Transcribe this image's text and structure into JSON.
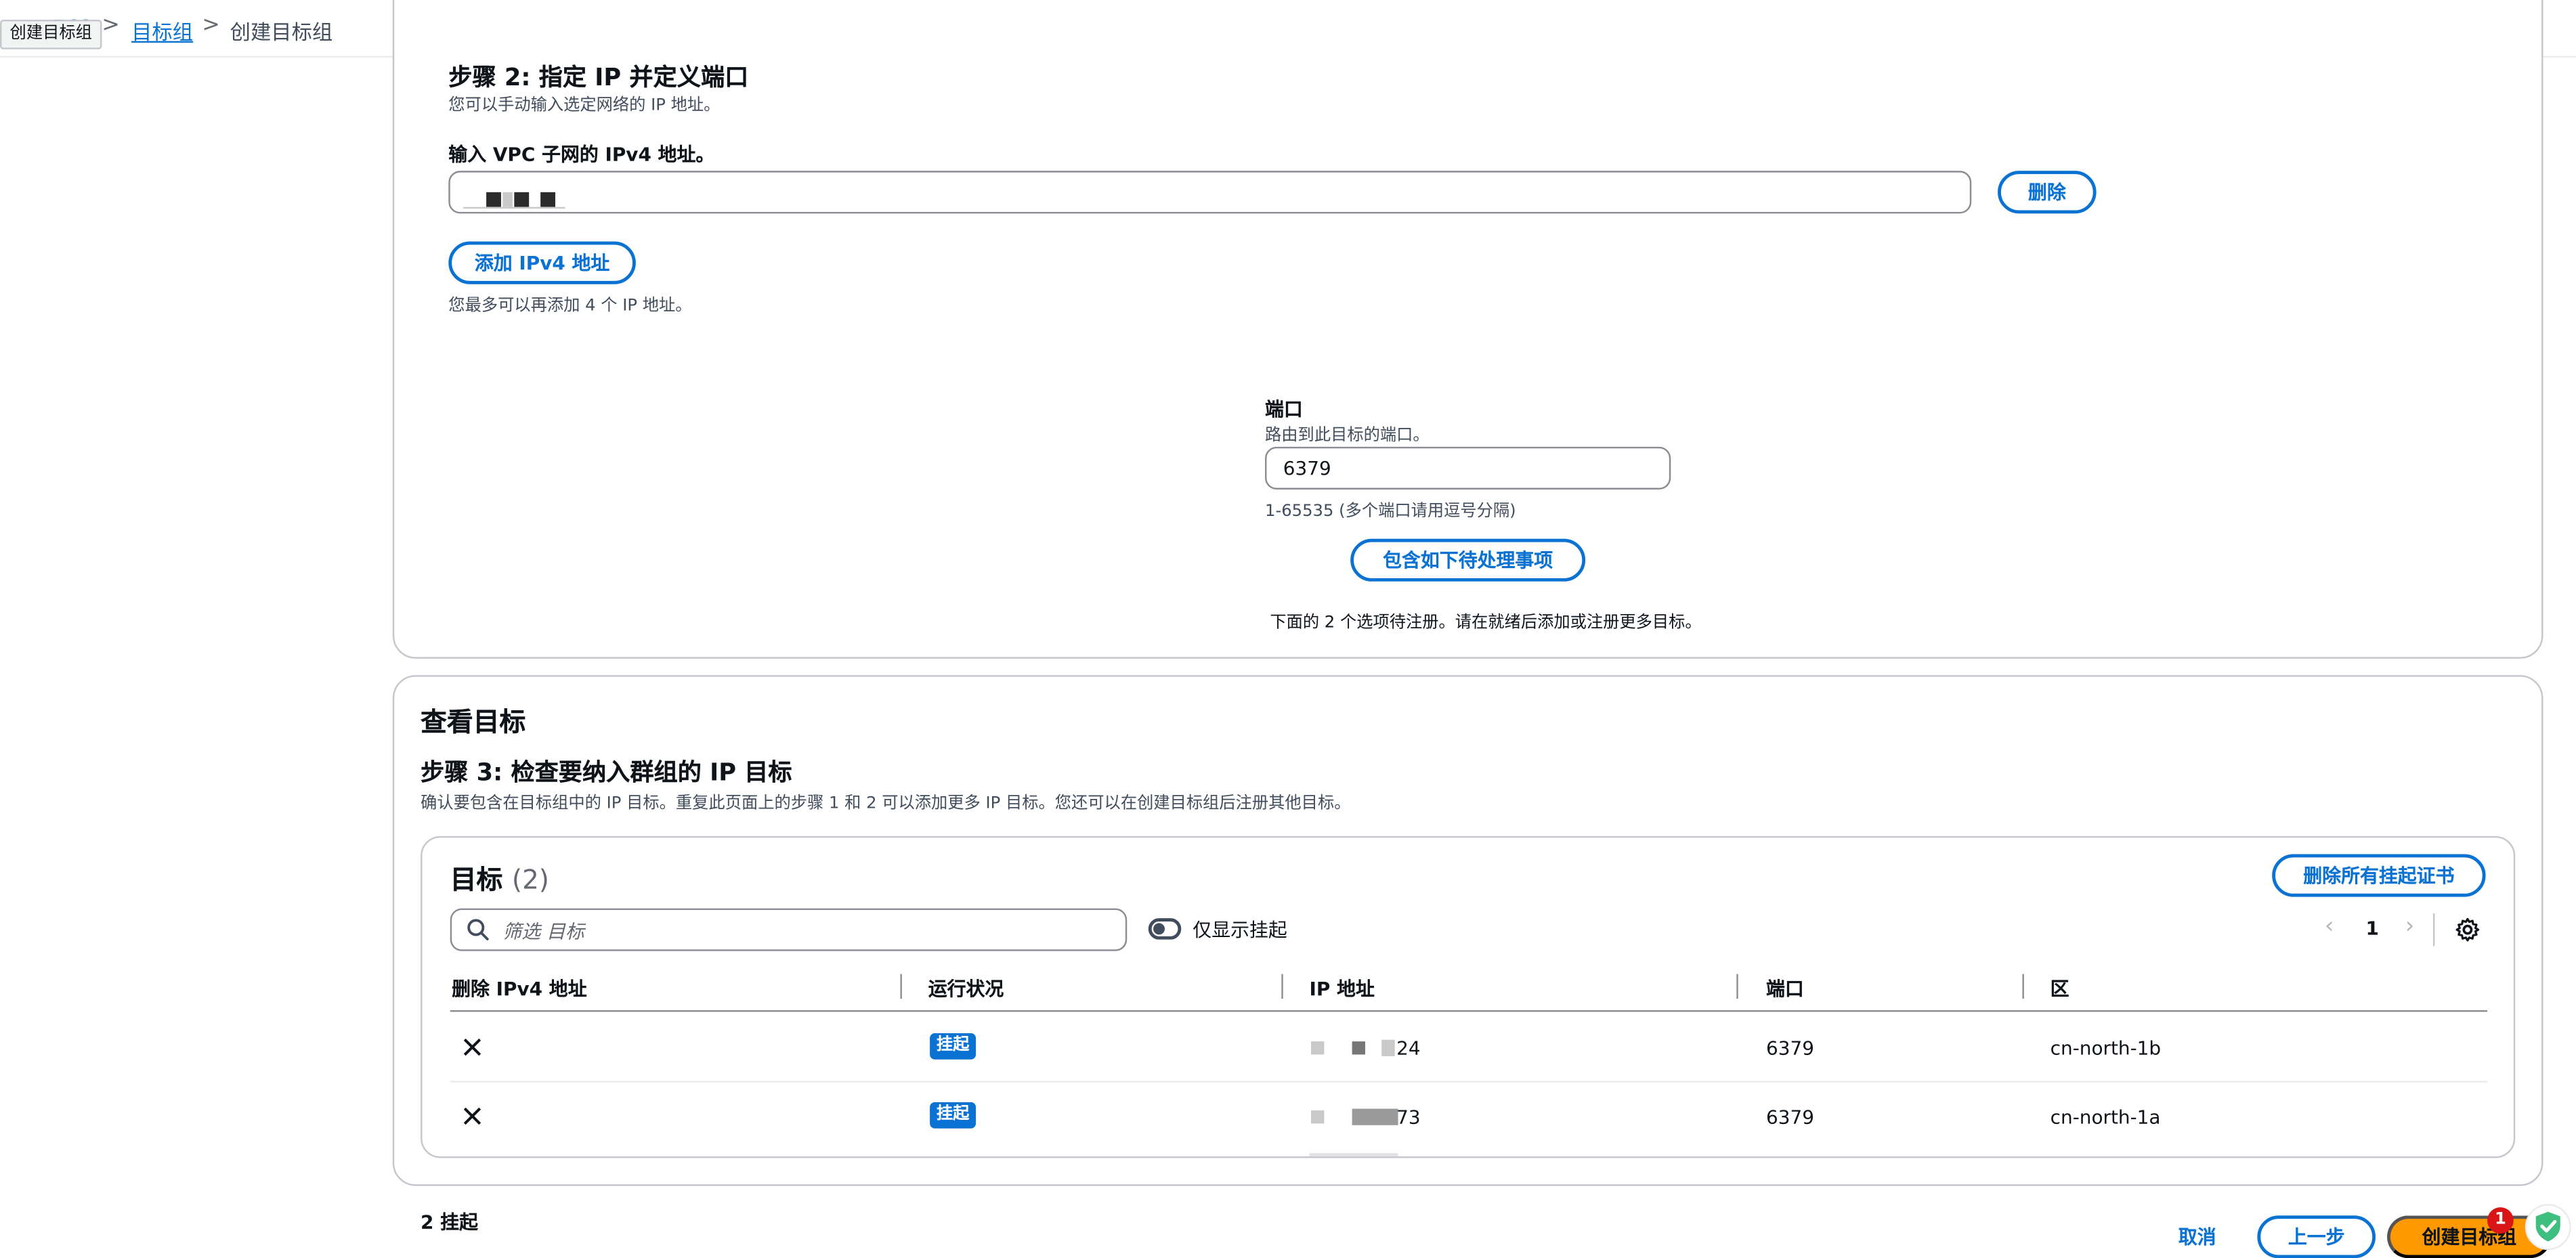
{
  "topbar": {
    "tooltip": "创建目标组",
    "crumb_link_1": "目标组",
    "crumb_current": "创建目标组",
    "separator": ">"
  },
  "step2": {
    "title": "步骤 2: 指定 IP 并定义端口",
    "desc": "您可以手动输入选定网络的 IP 地址。",
    "ipv4_label": "输入 VPC 子网的 IPv4 地址。",
    "remove_label": "删除",
    "add_ipv4_label": "添加 IPv4 地址",
    "add_hint": "您最多可以再添加 4 个 IP 地址。",
    "port_label": "端口",
    "port_desc": "路由到此目标的端口。",
    "port_value": "6379",
    "port_hint": "1-65535 (多个端口请用逗号分隔)",
    "include_pending_label": "包含如下待处理事项",
    "pending_note": "下面的 2 个选项待注册。请在就绪后添加或注册更多目标。"
  },
  "review": {
    "section_title": "查看目标",
    "step3_title": "步骤 3: 检查要纳入群组的 IP 目标",
    "step3_desc": "确认要包含在目标组中的 IP 目标。重复此页面上的步骤 1 和 2 可以添加更多 IP 目标。您还可以在创建目标组后注册其他目标。",
    "targets_title": "目标",
    "targets_count": "(2)",
    "remove_all_pending_label": "删除所有挂起证书",
    "filter_placeholder": "筛选 目标",
    "toggle_label": "仅显示挂起",
    "page_number": "1",
    "columns": [
      "删除 IPv4 地址",
      "运行状况",
      "IP 地址",
      "端口",
      "区"
    ],
    "rows": [
      {
        "status": "挂起",
        "ip_suffix": "24",
        "port": "6379",
        "zone": "cn-north-1b"
      },
      {
        "status": "挂起",
        "ip_suffix": "73",
        "port": "6379",
        "zone": "cn-north-1a"
      }
    ]
  },
  "footer": {
    "pending_count": "2 挂起",
    "cancel_label": "取消",
    "prev_label": "上一步",
    "create_label": "创建目标组",
    "notification_count": "1"
  },
  "colors": {
    "primary_blue": "#0972d3",
    "orange": "#ff9900",
    "border": "#c6c6cd",
    "text": "#0f141a"
  }
}
